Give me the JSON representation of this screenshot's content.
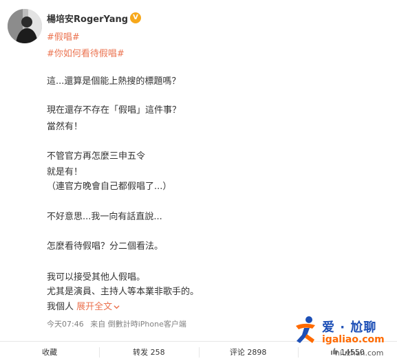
{
  "post": {
    "author": "楊培安RogerYang",
    "verified_badge": "V",
    "hashtags": [
      "#假唱#",
      "#你如何看待假唱#"
    ],
    "lines": [
      "這...還算是個能上熱搜的標題嗎？",
      "現在還存不存在「假唱」這件事？",
      "當然有！",
      "不管官方再怎麼三申五令",
      "就是有！",
      "（連官方晚會自己都假唱了...）",
      "不好意思...我一向有話直說...",
      "怎麼看待假唱？分二個看法。",
      "我可以接受其他人假唱。",
      "尤其是演員、主持人等本業非歌手的。",
      "我個人"
    ],
    "expand_label": "展开全文",
    "expand_icon": "chevron-down",
    "time": "今天07:46",
    "source_prefix": "来自",
    "source": "倒數計時iPhone客户端"
  },
  "actions": {
    "favorite": "收藏",
    "repost": "转发 258",
    "comment": "评论 2898",
    "like": "14550"
  },
  "watermark": {
    "title": "爱 · 尬聊",
    "url": "igaliao.com",
    "url2": "niuzhan.com"
  },
  "colors": {
    "link": "#eb7350",
    "badge": "#f7a81b",
    "text": "#333333",
    "meta": "#808080"
  }
}
